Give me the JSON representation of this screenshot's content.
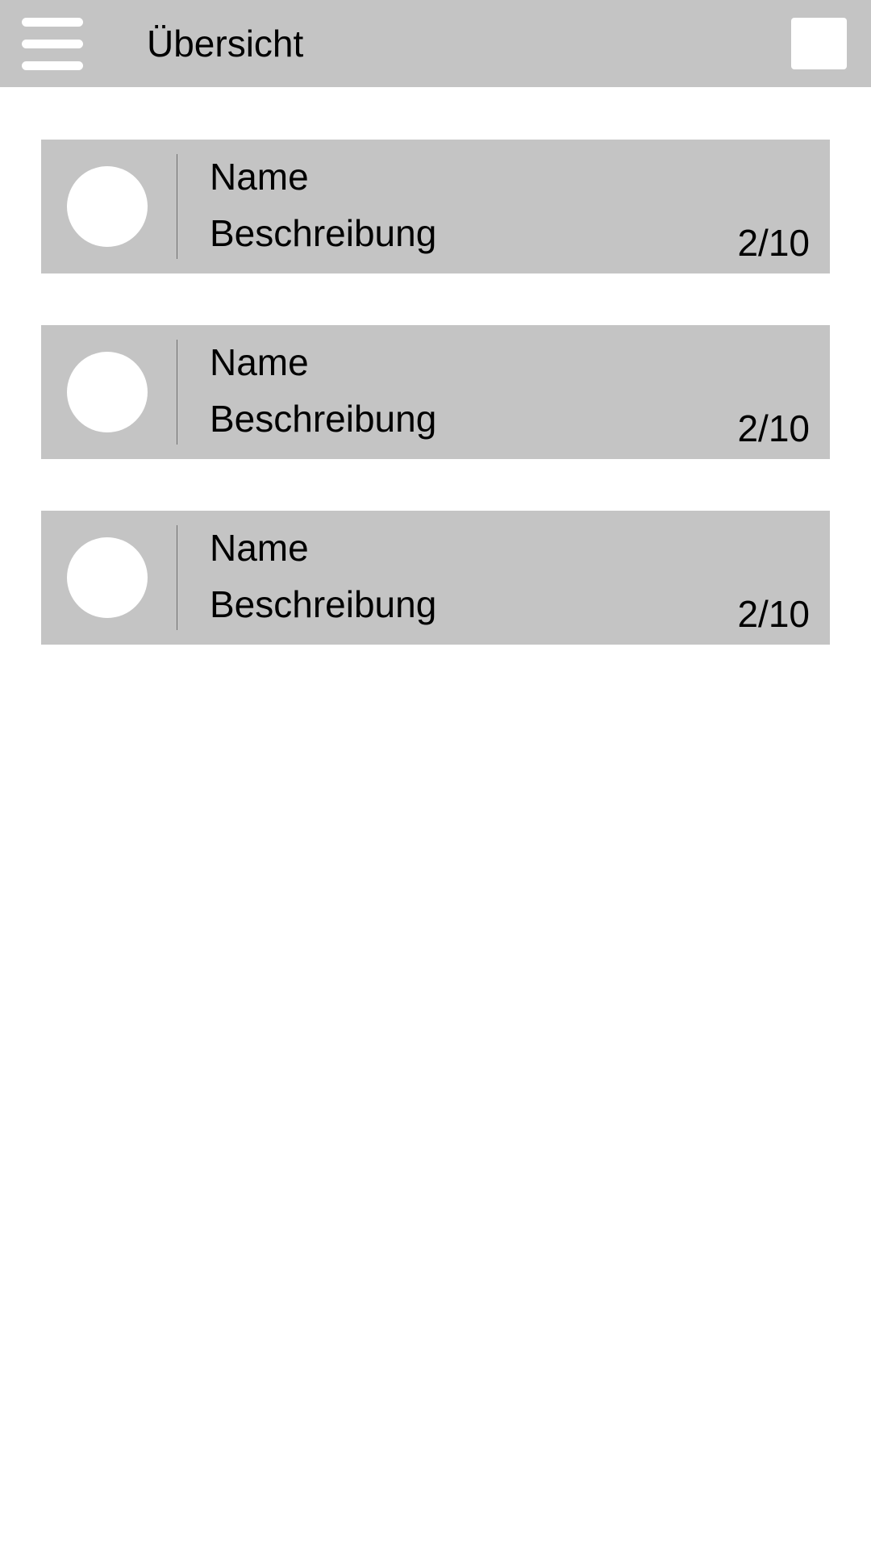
{
  "header": {
    "title": "Übersicht",
    "menu_icon": "hamburger-menu-icon",
    "action_icon": "blank-square-icon"
  },
  "items": [
    {
      "name": "Name",
      "description": "Beschreibung",
      "count": "2/10"
    },
    {
      "name": "Name",
      "description": "Beschreibung",
      "count": "2/10"
    },
    {
      "name": "Name",
      "description": "Beschreibung",
      "count": "2/10"
    }
  ],
  "colors": {
    "app_bar": "#c4c4c4",
    "card": "#c4c4c4",
    "background": "#ffffff"
  }
}
